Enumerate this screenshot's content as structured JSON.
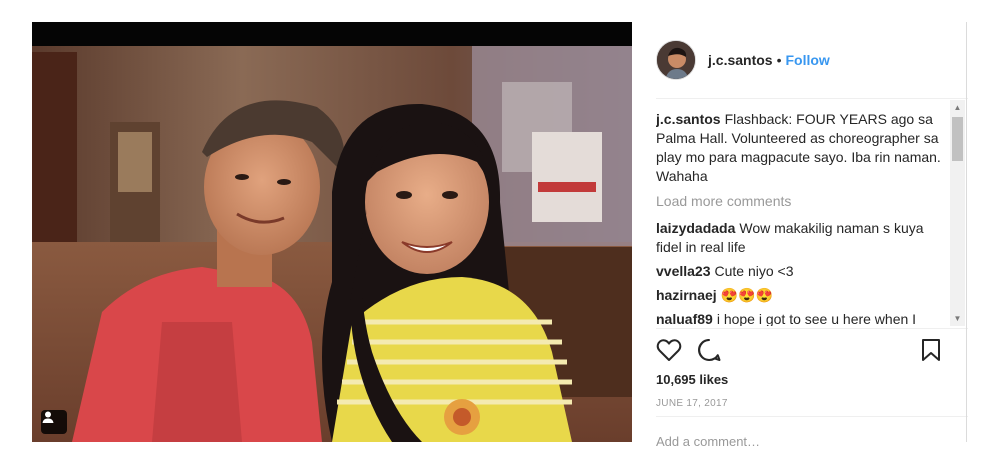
{
  "post": {
    "username": "j.c.santos",
    "separator": "•",
    "follow_label": "Follow",
    "caption": {
      "user": "j.c.santos",
      "text": "Flashback: FOUR YEARS ago sa Palma Hall. Volunteered as choreographer sa play mo para magpacute sayo. Iba rin naman. Wahaha"
    },
    "load_more_label": "Load more comments",
    "comments": [
      {
        "user": "laizydadada",
        "text": "Wow makakilig naman s kuya fidel in real life"
      },
      {
        "user": "vvella23",
        "text": "Cute niyo <3"
      },
      {
        "user": "hazirnaej",
        "text": "😍😍😍"
      },
      {
        "user": "naluaf89",
        "text": "i hope i got to see u here when I"
      }
    ],
    "likes": "10,695 likes",
    "date": "JUNE 17, 2017",
    "add_comment_placeholder": "Add a comment…"
  },
  "icons": {
    "like": "heart-icon",
    "comment": "comment-bubble-icon",
    "save": "bookmark-icon",
    "tag": "person-tag-icon"
  },
  "colors": {
    "link": "#3897f0",
    "muted": "#999999",
    "text": "#262626",
    "divider": "#efefef"
  }
}
